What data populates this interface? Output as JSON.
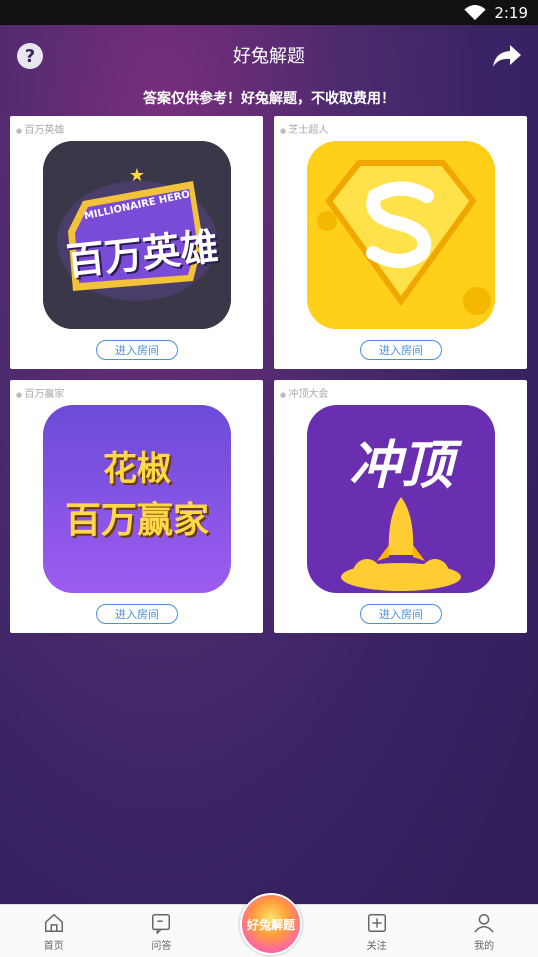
{
  "status": {
    "time": "2:19"
  },
  "header": {
    "title": "好兔解题",
    "help": "?"
  },
  "notice": "答案仅供参考！好兔解题，不收取费用！",
  "cards": [
    {
      "name": "百万英雄",
      "enter": "进入房间",
      "logo_text1": "MILLIONAIRE HERO",
      "logo_text2": "百万英雄"
    },
    {
      "name": "芝士超人",
      "enter": "进入房间"
    },
    {
      "name": "百万赢家",
      "enter": "进入房间",
      "logo_text1": "花椒",
      "logo_text2": "百万赢家"
    },
    {
      "name": "冲顶大会",
      "enter": "进入房间",
      "logo_text1": "冲顶"
    }
  ],
  "tabs": [
    {
      "label": "首页",
      "icon": "home-icon"
    },
    {
      "label": "问答",
      "icon": "qa-icon"
    },
    {
      "label": "",
      "icon": "app-logo"
    },
    {
      "label": "关注",
      "icon": "add-icon"
    },
    {
      "label": "我的",
      "icon": "user-icon"
    }
  ],
  "center_badge": "好兔解题",
  "colors": {
    "bg": "#3a2466",
    "accent": "#4a8fd9",
    "card_bg": "#ffffff"
  }
}
